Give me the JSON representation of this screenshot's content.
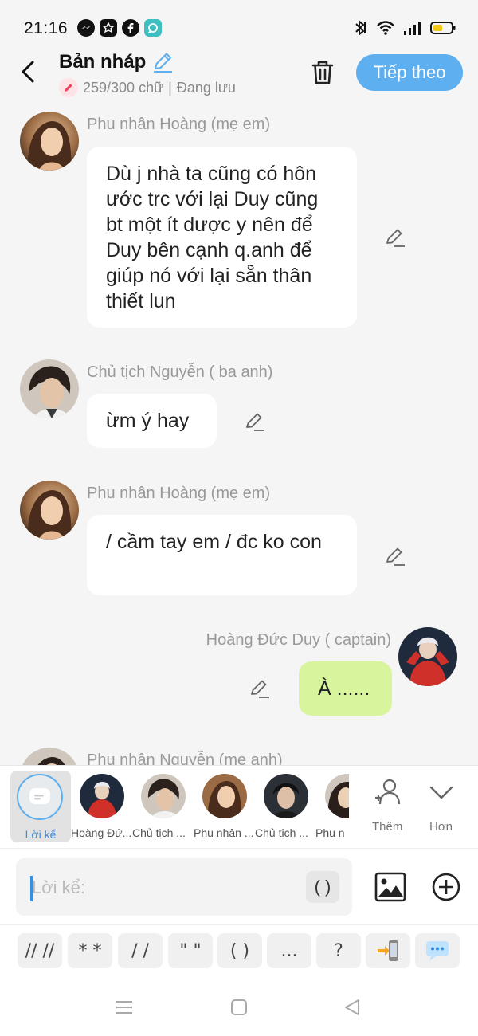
{
  "status_bar": {
    "time": "21:16",
    "icons": [
      "messenger-icon",
      "app-badge-icon",
      "facebook-icon",
      "chat-app-icon",
      "bluetooth-icon",
      "wifi-icon",
      "signal-icon",
      "battery-icon"
    ]
  },
  "header": {
    "title": "Bản nháp",
    "counter": "259/300 chữ",
    "separator": "|",
    "save_status": "Đang lưu",
    "next_button": "Tiếp theo"
  },
  "messages": [
    {
      "sender": "Phu nhân Hoàng (mẹ em)",
      "side": "left",
      "text": "Dù j nhà ta cũng có hôn ước trc với lại Duy cũng bt một ít dược y nên để Duy bên cạnh q.anh để giúp nó với lại sẵn thân thiết lun"
    },
    {
      "sender": "Chủ tịch Nguyễn ( ba anh)",
      "side": "left",
      "text": "ừm ý hay"
    },
    {
      "sender": "Phu nhân Hoàng (mẹ em)",
      "side": "left",
      "text": "/ cầm tay em / đc ko con"
    },
    {
      "sender": "Hoàng Đức Duy ( captain)",
      "side": "right",
      "text": "À ......"
    },
    {
      "sender": "Phu nhân Nguyễn (mẹ anh)",
      "side": "left",
      "text": ""
    }
  ],
  "character_bar": {
    "narrator_label": "Lời kể",
    "characters": [
      {
        "label": "Hoàng Đứ..."
      },
      {
        "label": "Chủ tịch ..."
      },
      {
        "label": "Phu nhân ..."
      },
      {
        "label": "Chủ tịch ..."
      },
      {
        "label": "Phu n"
      }
    ],
    "add_label": "Thêm",
    "more_label": "Hơn"
  },
  "input": {
    "placeholder": "Lời kể:",
    "paren_button": "( )"
  },
  "shortcuts": [
    "// //",
    "* *",
    "/ /",
    "\" \"",
    "( )",
    "...",
    "?"
  ],
  "colors": {
    "accent": "#5eaff0",
    "self_bubble": "#d8f59e",
    "bubble": "#ffffff",
    "background": "#f5f5f5"
  }
}
